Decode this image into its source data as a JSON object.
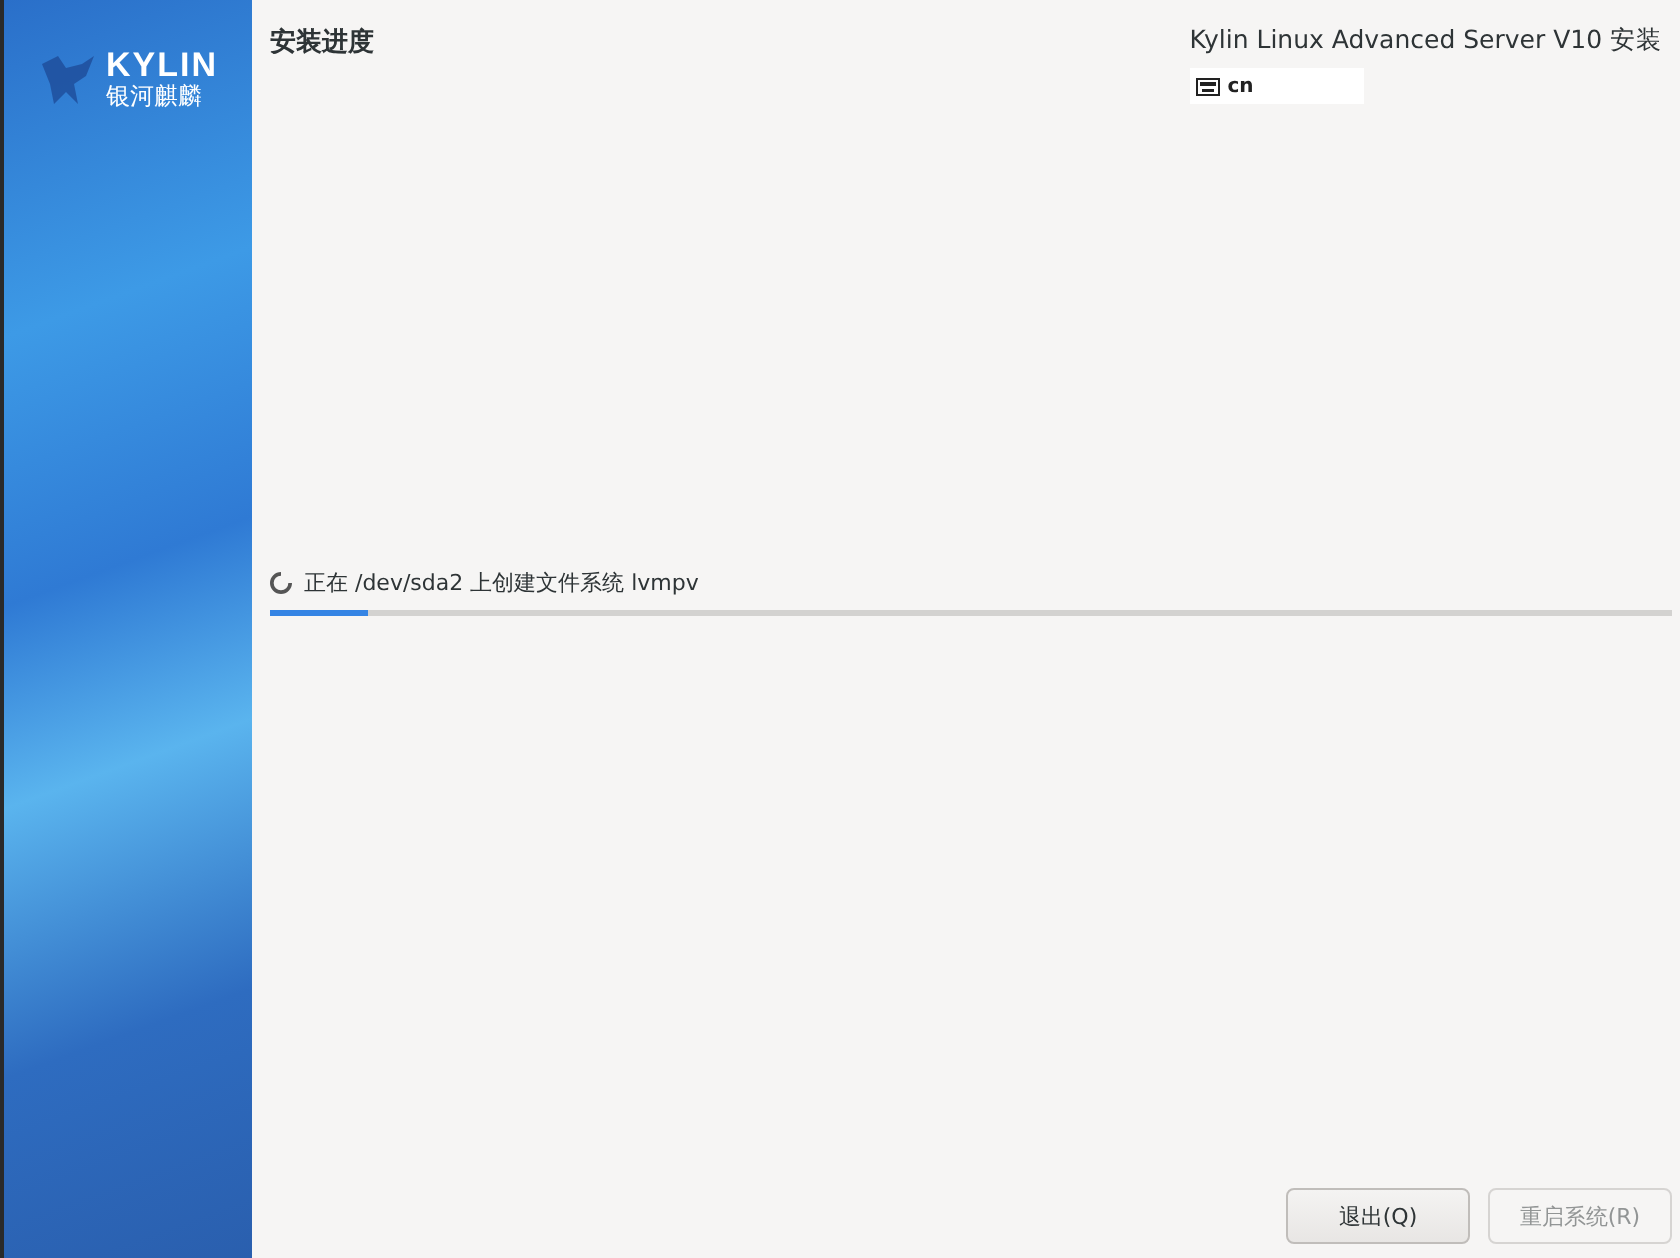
{
  "sidebar": {
    "logo": {
      "name": "KYLIN",
      "subtitle": "银河麒麟"
    }
  },
  "header": {
    "title": "安装进度",
    "product": "Kylin Linux Advanced Server V10 安装",
    "keyboard_layout": "cn"
  },
  "progress": {
    "status": "正在 /dev/sda2 上创建文件系统 lvmpv",
    "level": 0.07
  },
  "buttons": [
    {
      "label": "退出(Q)",
      "disabled": false
    },
    {
      "label": "重启系统(R)",
      "disabled": true
    }
  ]
}
